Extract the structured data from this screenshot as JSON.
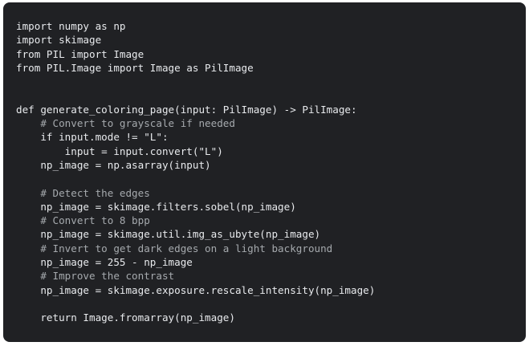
{
  "theme": {
    "background": "#202124",
    "text_color": "#e8eaed",
    "comment_color": "#a5a9ad"
  },
  "code": {
    "language": "python",
    "lines": [
      {
        "text": "import numpy as np",
        "kind": "code"
      },
      {
        "text": "import skimage",
        "kind": "code"
      },
      {
        "text": "from PIL import Image",
        "kind": "code"
      },
      {
        "text": "from PIL.Image import Image as PilImage",
        "kind": "code"
      },
      {
        "text": "",
        "kind": "blank"
      },
      {
        "text": "",
        "kind": "blank"
      },
      {
        "text": "def generate_coloring_page(input: PilImage) -> PilImage:",
        "kind": "code"
      },
      {
        "text": "    # Convert to grayscale if needed",
        "kind": "comment"
      },
      {
        "text": "    if input.mode != \"L\":",
        "kind": "code"
      },
      {
        "text": "        input = input.convert(\"L\")",
        "kind": "code"
      },
      {
        "text": "    np_image = np.asarray(input)",
        "kind": "code"
      },
      {
        "text": "",
        "kind": "blank"
      },
      {
        "text": "    # Detect the edges",
        "kind": "comment"
      },
      {
        "text": "    np_image = skimage.filters.sobel(np_image)",
        "kind": "code"
      },
      {
        "text": "    # Convert to 8 bpp",
        "kind": "comment"
      },
      {
        "text": "    np_image = skimage.util.img_as_ubyte(np_image)",
        "kind": "code"
      },
      {
        "text": "    # Invert to get dark edges on a light background",
        "kind": "comment"
      },
      {
        "text": "    np_image = 255 - np_image",
        "kind": "code"
      },
      {
        "text": "    # Improve the contrast",
        "kind": "comment"
      },
      {
        "text": "    np_image = skimage.exposure.rescale_intensity(np_image)",
        "kind": "code"
      },
      {
        "text": "",
        "kind": "blank"
      },
      {
        "text": "    return Image.fromarray(np_image)",
        "kind": "code"
      }
    ]
  }
}
